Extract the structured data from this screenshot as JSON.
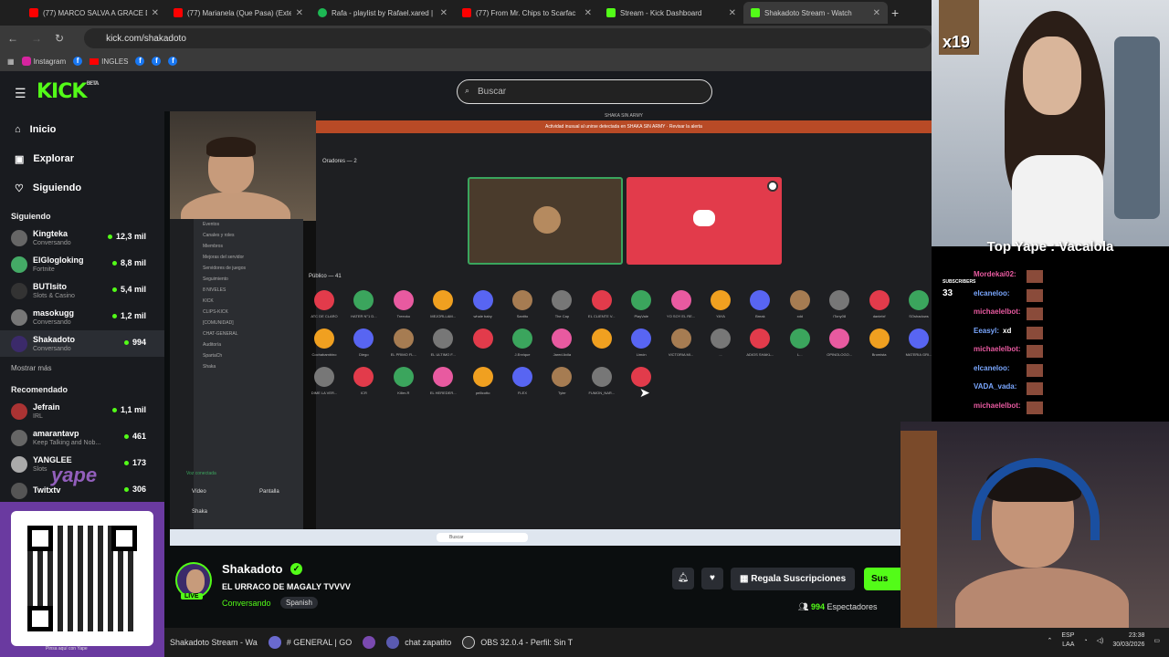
{
  "browser": {
    "tabs": [
      {
        "title": "(77) MARCO SALVA A GRACE D",
        "color": "#ff0000"
      },
      {
        "title": "(77) Marianela (Que Pasa) (Exte",
        "color": "#ff0000"
      },
      {
        "title": "Rafa - playlist by Rafael.xared |",
        "color": "#1db954"
      },
      {
        "title": "(77) From Mr. Chips to Scarfac",
        "color": "#ff0000"
      },
      {
        "title": "Stream - Kick Dashboard",
        "color": "#53fc18"
      },
      {
        "title": "Shakadoto Stream - Watch",
        "color": "#53fc18"
      }
    ],
    "url": "kick.com/shakadoto",
    "bookmarks": [
      "Instagram",
      "INGLES"
    ]
  },
  "kick": {
    "logo": "KICK",
    "logo_badge": "BETA",
    "search_placeholder": "Buscar",
    "nav": [
      {
        "label": "Inicio",
        "icon": "home-icon"
      },
      {
        "label": "Explorar",
        "icon": "compass-icon"
      },
      {
        "label": "Siguiendo",
        "icon": "heart-icon"
      }
    ],
    "following_title": "Siguiendo",
    "following": [
      {
        "name": "Kingteka",
        "sub": "Conversando",
        "viewers": "12,3 mil",
        "color": "#555"
      },
      {
        "name": "ElGlogloking",
        "sub": "Fortnite",
        "viewers": "8,8 mil",
        "color": "#4a6"
      },
      {
        "name": "BUTIsito",
        "sub": "Slots & Casino",
        "viewers": "5,4 mil",
        "color": "#333"
      },
      {
        "name": "masokugg",
        "sub": "Conversando",
        "viewers": "1,2 mil",
        "color": "#777"
      },
      {
        "name": "Shakadoto",
        "sub": "Conversando",
        "viewers": "994",
        "color": "#3b2a6a"
      }
    ],
    "show_more": "Mostrar más",
    "recommended_title": "Recomendado",
    "recommended": [
      {
        "name": "Jefrain",
        "sub": "IRL",
        "viewers": "1,1 mil",
        "color": "#a33"
      },
      {
        "name": "amarantavp",
        "sub": "Keep Talking and Nob...",
        "viewers": "461",
        "color": "#666"
      },
      {
        "name": "YANGLEE",
        "sub": "Slots",
        "viewers": "173",
        "color": "#aaa"
      },
      {
        "name": "Twitxtv",
        "sub": "",
        "viewers": "306",
        "color": "#555"
      }
    ]
  },
  "discord": {
    "window_title": "SHAKA SIN ARMY",
    "alert": "Actividad inusual al unirse detectada en SHAKA SIN ARMY · Revisar la alerta",
    "speakers_label": "Oradores — 2",
    "public_label": "Público — 41",
    "channels": [
      "Eventos",
      "Canales y roles",
      "Miembros",
      "Mejoras del servidor",
      "Servidores de juegos",
      "Seguimiento",
      "8 NIVELES",
      "KICK",
      "CLIPS-KICK",
      "[COMUNIDAD]",
      "CHAT-GENERAL",
      "Auditoría",
      "SpartaCh",
      "Shaka"
    ],
    "voice_status": "Voz conectada",
    "video_btn": "Vídeo",
    "screen_btn": "Pantalla",
    "user": "Shaka",
    "audience_row1": [
      "ATC DE CLARO",
      "HATER N°1 D...",
      "Treecko",
      "MEJORLLAM...",
      "whale baby",
      "Santito",
      "The Cap",
      "EL CLIENTE V...",
      "PlayVale",
      "YO SOY EL RE...",
      "YAYA",
      "Break",
      "xdd",
      "iTony08",
      "danielxf",
      "SOshadows"
    ],
    "audience_row2": [
      "Cochabambino",
      "Diego",
      "EL PRIMO FL...",
      "EL ULTIMO F...",
      "",
      "J.Enrique",
      "Jared Avila",
      "",
      "Limón",
      "VICTORIA MI...",
      "...",
      "ADIOS SHAKL...",
      "L...",
      "OPINOLOGO...",
      "Bromista",
      "MATERIA GRI..."
    ],
    "audience_row3": [
      "DIME LA VER...",
      "ICR",
      "Killer-R",
      "EL HEREDER...",
      "pellicotto",
      "FLEX",
      "Tyler",
      "FUMON_NAR...",
      ""
    ]
  },
  "stream": {
    "name": "Shakadoto",
    "live_label": "LIVE",
    "title": "EL URRACO DE MAGALY TVVVV",
    "category": "Conversando",
    "language": "Spanish",
    "gift_label": "Regala Suscripciones",
    "subscribe_label": "Sus",
    "viewers_count": "994",
    "viewers_label": "Espectadores"
  },
  "overlay": {
    "multiplier": "x19",
    "top_yape": "Top Yape : Vacalola",
    "subscribers_label": "SUBSCRIBERS",
    "subscribers_count": "33",
    "chat": [
      {
        "user": "Mordekai02:",
        "color": "#e85aa0"
      },
      {
        "user": "elcaneloo:",
        "color": "#7aa7ff"
      },
      {
        "user": "michaelelbot:",
        "color": "#e85aa0"
      },
      {
        "user": "Eeasyl:",
        "text": "xd",
        "color": "#7aa7ff"
      },
      {
        "user": "michaelelbot:",
        "color": "#e85aa0"
      },
      {
        "user": "elcaneloo:",
        "color": "#7aa7ff"
      },
      {
        "user": "VADA_vada:",
        "color": "#7aa7ff"
      },
      {
        "user": "michaelelbot:",
        "color": "#e85aa0"
      }
    ],
    "qr_caption": "Pinsa aquí con Yape",
    "yape_logo": "yape"
  },
  "taskbar": {
    "items": [
      {
        "label": "Shakadoto Stream - Wa",
        "icon": "browser-icon"
      },
      {
        "label": "# GENERAL | GO",
        "icon": "discord-icon"
      },
      {
        "label": "",
        "icon": "app-icon"
      },
      {
        "label": "chat zapatito",
        "icon": "chat-icon"
      },
      {
        "label": "OBS 32.0.4 - Perfil: Sin T",
        "icon": "obs-icon"
      }
    ],
    "lang": "ESP",
    "lang2": "LAA",
    "time": "23:38",
    "date": "30/03/2026"
  }
}
